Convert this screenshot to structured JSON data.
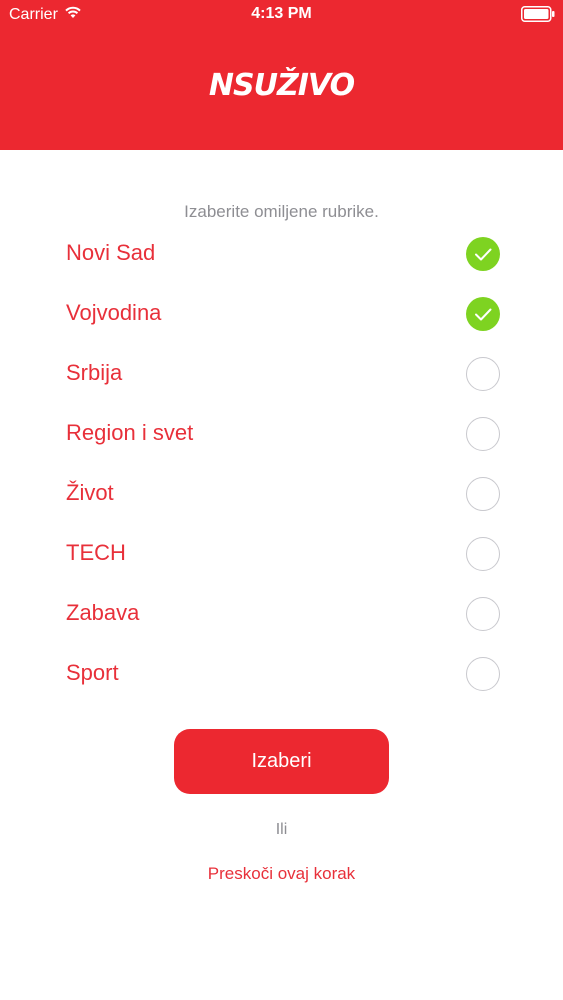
{
  "status_bar": {
    "carrier": "Carrier",
    "time": "4:13 PM",
    "icons": [
      "wifi-icon",
      "battery-icon"
    ]
  },
  "header": {
    "logo": "NSUŽIVO"
  },
  "instruction": "Izaberite omiljene rubrike.",
  "topics": [
    {
      "label": "Novi Sad",
      "selected": true
    },
    {
      "label": "Vojvodina",
      "selected": true
    },
    {
      "label": "Srbija",
      "selected": false
    },
    {
      "label": "Region i svet",
      "selected": false
    },
    {
      "label": "Život",
      "selected": false
    },
    {
      "label": "TECH",
      "selected": false
    },
    {
      "label": "Zabava",
      "selected": false
    },
    {
      "label": "Sport",
      "selected": false
    }
  ],
  "actions": {
    "primary_label": "Izaberi",
    "or_label": "Ili",
    "skip_label": "Preskoči ovaj korak"
  },
  "colors": {
    "brand_red": "#ec2830",
    "topic_text": "#e8303a",
    "check_green": "#7ed321",
    "muted_gray": "#8e8e93"
  }
}
